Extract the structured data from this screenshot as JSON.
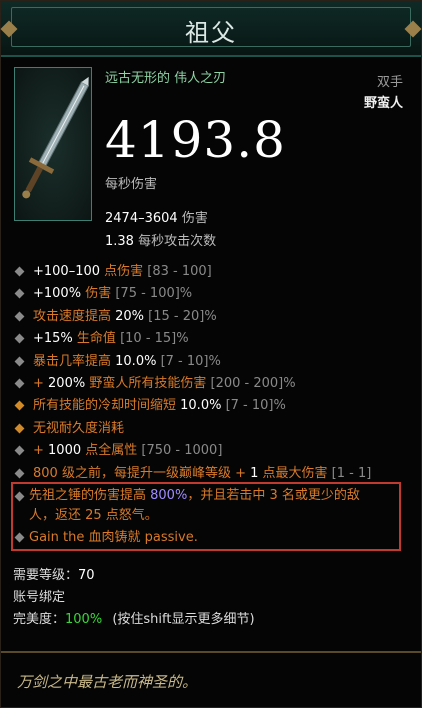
{
  "header": {
    "title": "祖父"
  },
  "item": {
    "subtitle": "远古无形的 伟人之刃",
    "slot": "双手",
    "class": "野蛮人",
    "dps": "4193.8",
    "dps_label": "每秒伤害",
    "damage_value": "2474–3604",
    "damage_label": "伤害",
    "speed_value": "1.38",
    "speed_label": "每秒攻击次数",
    "image_icon": "great-sword-icon"
  },
  "affixes": [
    {
      "parts": [
        [
          "w",
          "+100–100 "
        ],
        [
          "o",
          "点伤害"
        ],
        [
          "g",
          " [83 - 100]"
        ]
      ]
    },
    {
      "parts": [
        [
          "w",
          "+100% "
        ],
        [
          "o",
          "伤害"
        ],
        [
          "g",
          " [75 - 100]%"
        ]
      ]
    },
    {
      "parts": [
        [
          "o",
          "攻击速度提高 "
        ],
        [
          "w",
          "20%"
        ],
        [
          "g",
          " [15 - 20]%"
        ]
      ]
    },
    {
      "parts": [
        [
          "w",
          "+15% "
        ],
        [
          "o",
          "生命值"
        ],
        [
          "g",
          " [10 - 15]%"
        ]
      ]
    },
    {
      "parts": [
        [
          "o",
          "暴击几率提高 "
        ],
        [
          "w",
          "10.0%"
        ],
        [
          "g",
          " [7 - 10]%"
        ]
      ]
    },
    {
      "parts": [
        [
          "o",
          "+ "
        ],
        [
          "w",
          "200% "
        ],
        [
          "o",
          "野蛮人所有技能伤害"
        ],
        [
          "g",
          " [200 - 200]%"
        ]
      ]
    },
    {
      "bullet": "orange",
      "parts": [
        [
          "o",
          "所有技能的冷却时间缩短 "
        ],
        [
          "w",
          "10.0%"
        ],
        [
          "g",
          " [7 - 10]%"
        ]
      ]
    },
    {
      "bullet": "orange",
      "parts": [
        [
          "o",
          "无视耐久度消耗"
        ]
      ]
    },
    {
      "parts": [
        [
          "o",
          "+ "
        ],
        [
          "w",
          "1000 "
        ],
        [
          "o",
          "点全属性"
        ],
        [
          "g",
          " [750 - 1000]"
        ]
      ]
    },
    {
      "parts": [
        [
          "o",
          "800 级之前，每提升一级巅峰等级 + "
        ],
        [
          "w",
          "1 "
        ],
        [
          "o",
          "点最大伤害"
        ],
        [
          "g",
          " [1 - 1]"
        ]
      ]
    }
  ],
  "legendary": {
    "line1a": "先祖之锤的伤害提高 ",
    "line1b": "800%",
    "line1c": "，并且若击中 3 名或更少的敌",
    "line2": "人，返还 25 点怒气。",
    "line3": "Gain the 血肉铸就 passive."
  },
  "info": {
    "req_label": "需要等级：",
    "req_value": "70",
    "bound": "账号绑定",
    "perfection_label": "完美度：",
    "perfection_value": "100%",
    "perfection_hint": "(按住shift显示更多细节)"
  },
  "flavor": "万剑之中最古老而神圣的。",
  "colors": {
    "orange": "#d87a2a",
    "purple": "#a08bff",
    "green": "#38d838",
    "border": "#c13a2f"
  }
}
